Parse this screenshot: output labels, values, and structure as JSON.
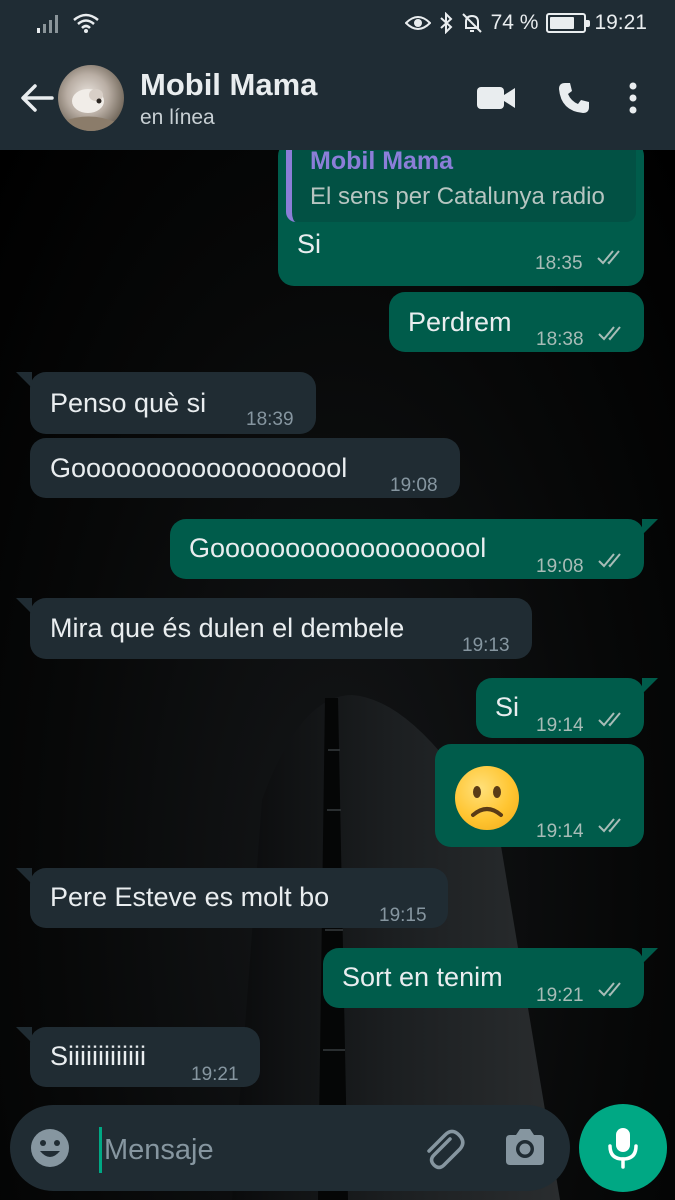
{
  "status_bar": {
    "battery_percent": "74 %",
    "battery_level": 0.74,
    "time": "19:21",
    "icons": [
      "signal-icon",
      "wifi-icon",
      "eye-icon",
      "bluetooth-icon",
      "mute-icon",
      "battery-icon"
    ]
  },
  "header": {
    "contact_name": "Mobil Mama",
    "contact_status": "en línea",
    "icons": [
      "back-arrow-icon",
      "video-call-icon",
      "voice-call-icon",
      "more-options-icon"
    ]
  },
  "messages": [
    {
      "direction": "out",
      "quote_author": "Mobil Mama",
      "quote_text": "El sens per Catalunya radio",
      "text": "Si",
      "time": "18:35",
      "read": true
    },
    {
      "direction": "out",
      "text": "Perdrem",
      "time": "18:38",
      "read": true
    },
    {
      "direction": "in",
      "text": "Penso què si",
      "time": "18:39"
    },
    {
      "direction": "in",
      "text": "Gooooooooooooooooool",
      "time": "19:08"
    },
    {
      "direction": "out",
      "text": "Gooooooooooooooooool",
      "time": "19:08",
      "read": true
    },
    {
      "direction": "in",
      "text": "Mira que és dulen el dembele",
      "time": "19:13"
    },
    {
      "direction": "out",
      "text": "Si",
      "time": "19:14",
      "read": true
    },
    {
      "direction": "out",
      "text": "☹️",
      "emoji": "frowning-face",
      "time": "19:14",
      "read": true
    },
    {
      "direction": "in",
      "text": "Pere Esteve es molt bo",
      "time": "19:15"
    },
    {
      "direction": "out",
      "text": "Sort en tenim",
      "time": "19:21",
      "read": true
    },
    {
      "direction": "in",
      "text": "Siiiiiiiiiiiii",
      "time": "19:21"
    }
  ],
  "input": {
    "placeholder": "Mensaje",
    "value": ""
  },
  "colors": {
    "header_bg": "#1f2c34",
    "outgoing_bubble": "#005c4b",
    "incoming_bubble": "#202c33",
    "accent": "#00a884",
    "quote_author": "#8b7ed8"
  }
}
